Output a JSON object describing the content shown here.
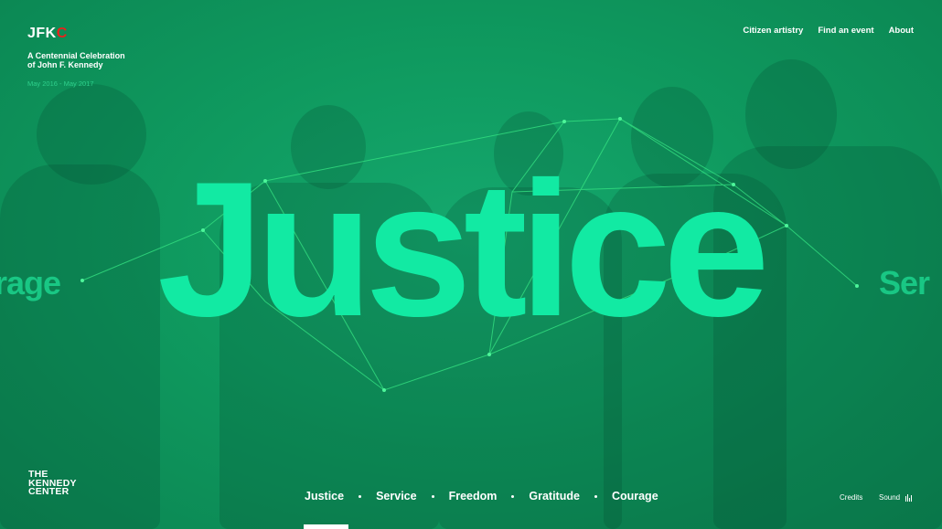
{
  "header": {
    "logo_main": "JFK",
    "logo_accent": "C",
    "subtitle_line1": "A Centennial Celebration",
    "subtitle_line2": "of John F. Kennedy",
    "dates": "May 2016 - May 2017"
  },
  "nav": {
    "items": [
      "Citizen artistry",
      "Find an event",
      "About"
    ]
  },
  "hero": {
    "word": "Justice",
    "left_peek": "rage",
    "right_peek": "Ser"
  },
  "footer": {
    "org_line1": "THE",
    "org_line2": "KENNEDY",
    "org_line3": "CENTER",
    "values": [
      "Justice",
      "Service",
      "Freedom",
      "Gratitude",
      "Courage"
    ],
    "active_index": 0,
    "credits": "Credits",
    "sound": "Sound"
  },
  "colors": {
    "background": "#0f9a5f",
    "accent": "#12eaa3",
    "logo_red": "#e8221b"
  }
}
